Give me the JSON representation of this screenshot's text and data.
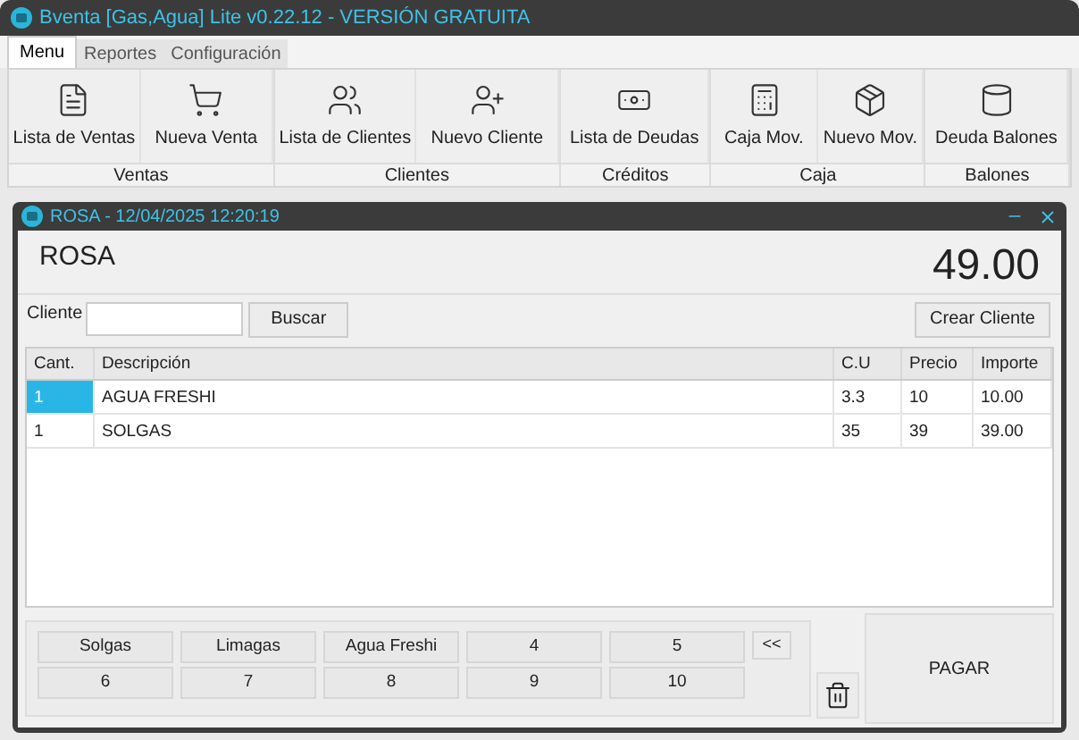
{
  "window": {
    "title": "Bventa [Gas,Agua] Lite v0.22.12 - VERSIÓN GRATUITA"
  },
  "tabs": [
    {
      "label": "Menu",
      "selected": true
    },
    {
      "label": "Reportes",
      "selected": false
    },
    {
      "label": "Configuración",
      "selected": false
    }
  ],
  "ribbon_groups": [
    {
      "label": "Ventas",
      "buttons": [
        {
          "label": "Lista de Ventas",
          "kind": "document"
        },
        {
          "label": "Nueva Venta",
          "kind": "cart"
        }
      ]
    },
    {
      "label": "Clientes",
      "buttons": [
        {
          "label": "Lista de Clientes",
          "kind": "users"
        },
        {
          "label": "Nuevo Cliente",
          "kind": "user-add"
        }
      ]
    },
    {
      "label": "Créditos",
      "buttons": [
        {
          "label": "Lista de Deudas",
          "kind": "money"
        }
      ]
    },
    {
      "label": "Caja",
      "buttons": [
        {
          "label": "Caja Mov.",
          "kind": "calculator"
        },
        {
          "label": "Nuevo Mov.",
          "kind": "box"
        }
      ]
    },
    {
      "label": "Balones",
      "buttons": [
        {
          "label": "Deuda Balones",
          "kind": "cylinder"
        }
      ]
    }
  ],
  "sale_window": {
    "title": "ROSA - 12/04/2025 12:20:19",
    "customer_name": "ROSA",
    "total": "49.00",
    "client_label": "Cliente",
    "search_button": "Buscar",
    "create_client_button": "Crear Cliente",
    "table": {
      "columns": [
        "Cant.",
        "Descripción",
        "C.U",
        "Precio",
        "Importe"
      ],
      "rows": [
        {
          "cells": [
            "1",
            "AGUA FRESHI",
            "3.3",
            "10",
            "10.00"
          ],
          "selected": true
        },
        {
          "cells": [
            "1",
            "SOLGAS",
            "35",
            "39",
            "39.00"
          ],
          "selected": false
        }
      ]
    },
    "quick_buttons": [
      "Solgas",
      "Limagas",
      "Agua Freshi",
      "4",
      "5",
      "6",
      "7",
      "8",
      "9",
      "10"
    ],
    "back_button": "<<",
    "pay_button": "PAGAR"
  }
}
